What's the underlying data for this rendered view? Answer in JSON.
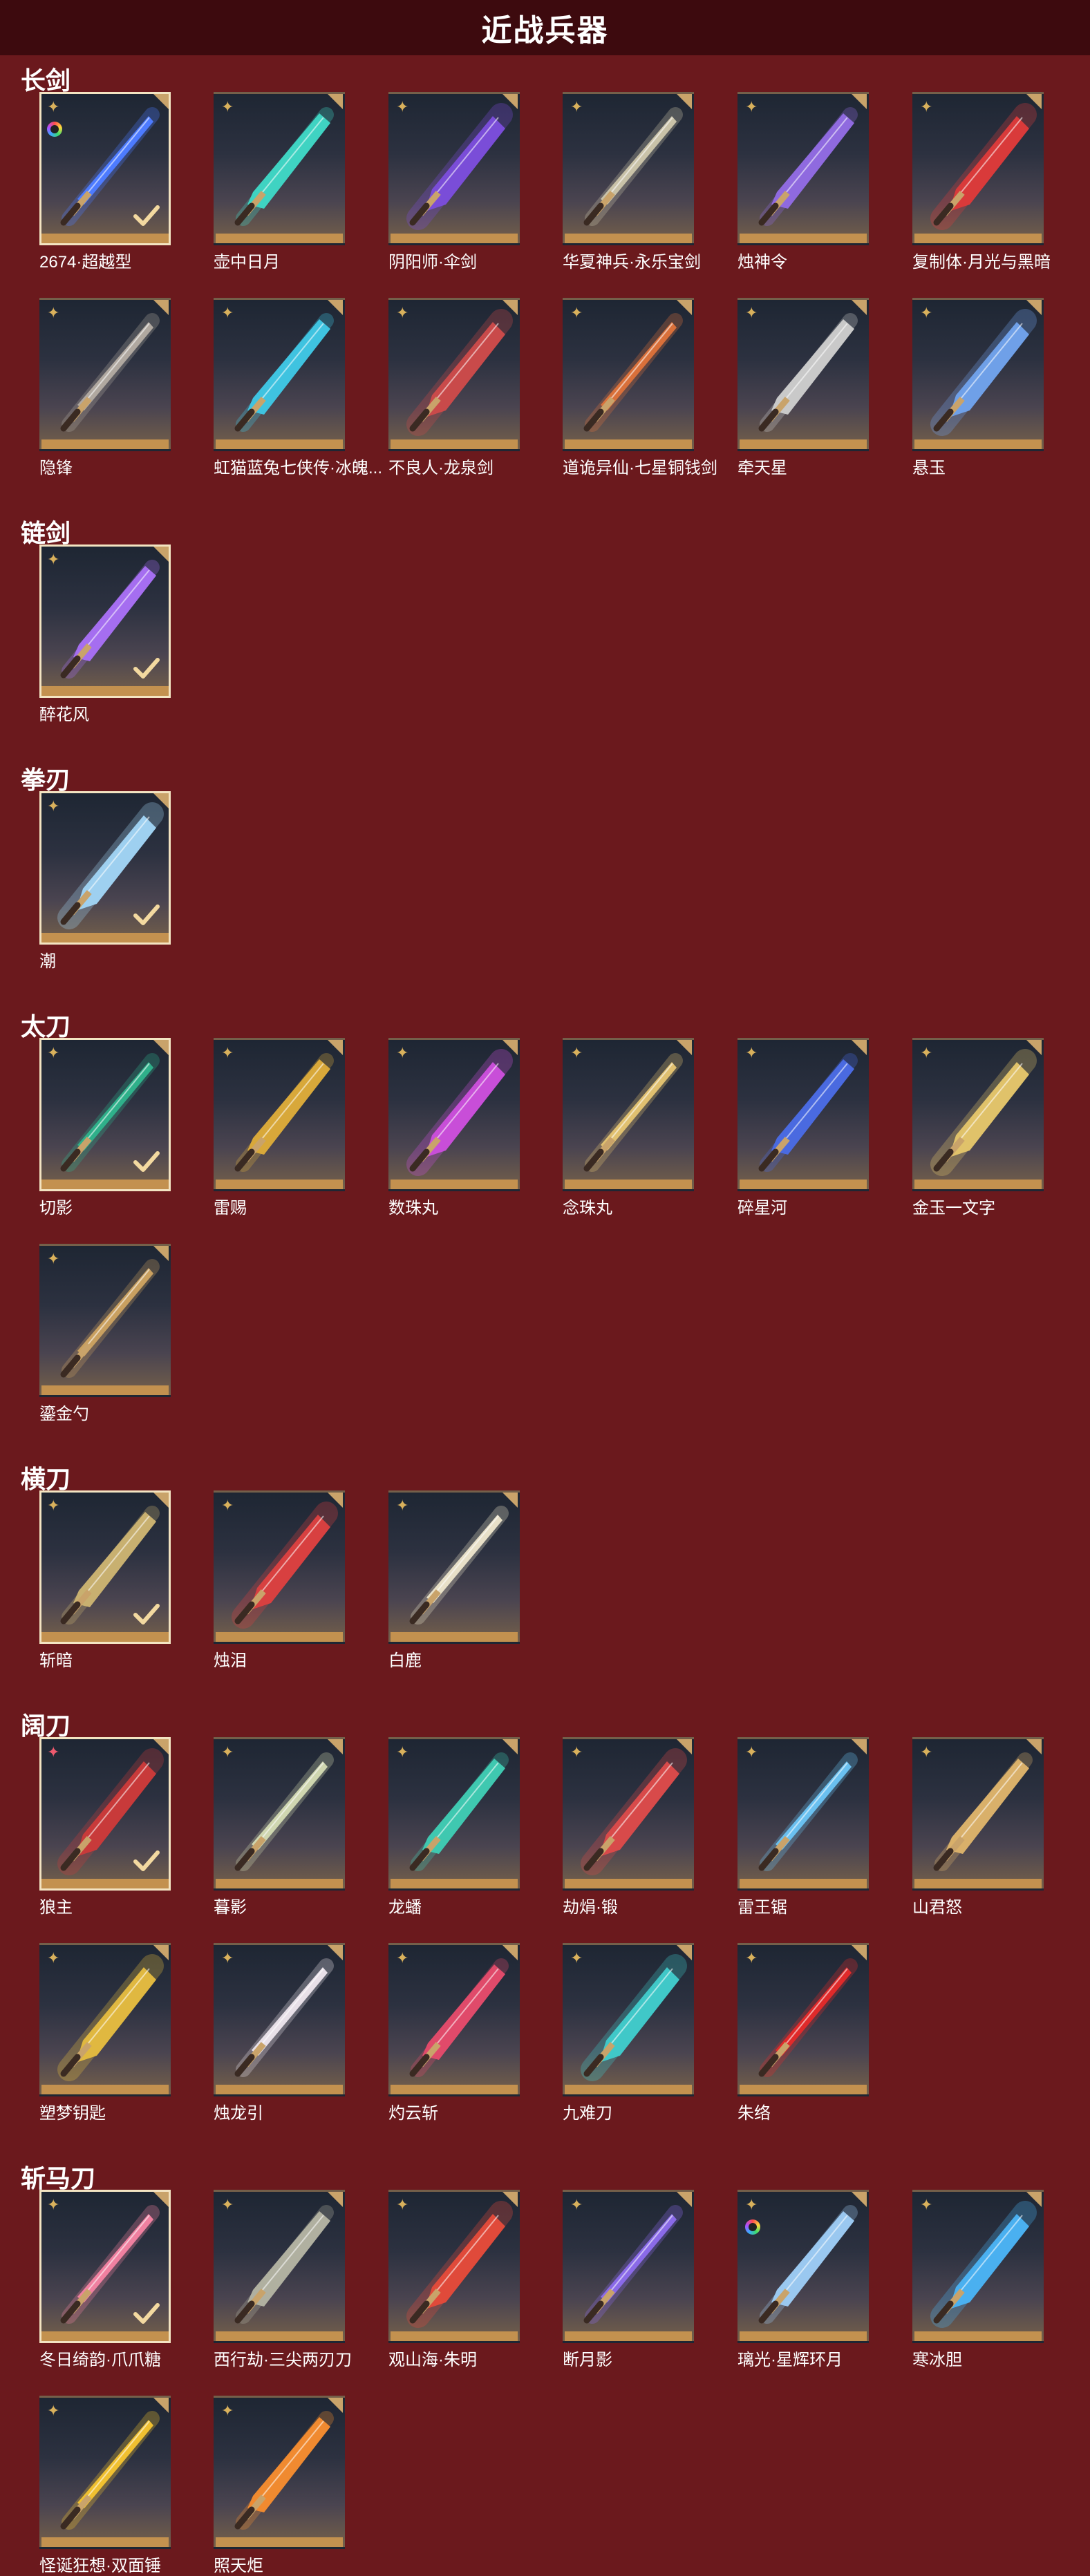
{
  "page": {
    "title": "近战兵器"
  },
  "categories": [
    {
      "name": "长剑",
      "items": [
        {
          "label": "2674·超越型",
          "star": "gold",
          "ring": true,
          "selected": true,
          "color": "#4d7bff"
        },
        {
          "label": "壶中日月",
          "star": "gold",
          "color": "#3fd3c2"
        },
        {
          "label": "阴阳师·伞剑",
          "star": "gold",
          "color": "#7a4dd8"
        },
        {
          "label": "华夏神兵·永乐宝剑",
          "star": "gold",
          "color": "#c9c2a8"
        },
        {
          "label": "烛神令",
          "star": "gold",
          "color": "#8f6adf"
        },
        {
          "label": "复制体·月光与黑暗",
          "star": "gold",
          "color": "#d93a3a"
        },
        {
          "label": "隐锋",
          "star": "gold",
          "color": "#b0a8a0"
        },
        {
          "label": "虹猫蓝兔七侠传·冰魄...",
          "star": "gold",
          "color": "#3fc3e0"
        },
        {
          "label": "不良人·龙泉剑",
          "star": "gold",
          "color": "#c94a4a"
        },
        {
          "label": "道诡异仙·七星铜钱剑",
          "star": "gold",
          "color": "#d9703a"
        },
        {
          "label": "牵天星",
          "star": "gold",
          "color": "#c9c9c9"
        },
        {
          "label": "悬玉",
          "star": "gold",
          "color": "#6fa0e8"
        }
      ]
    },
    {
      "name": "链剑",
      "items": [
        {
          "label": "醉花风",
          "star": "gold",
          "selected": true,
          "color": "#a56ef0"
        }
      ]
    },
    {
      "name": "拳刃",
      "items": [
        {
          "label": "潮",
          "star": "gold",
          "selected": true,
          "color": "#9ed0f0"
        }
      ]
    },
    {
      "name": "太刀",
      "items": [
        {
          "label": "切影",
          "star": "gold",
          "selected": true,
          "color": "#2fb08a"
        },
        {
          "label": "雷赐",
          "star": "gold",
          "color": "#d8a83a"
        },
        {
          "label": "数珠丸",
          "star": "gold",
          "color": "#c84ed8"
        },
        {
          "label": "念珠丸",
          "star": "gold",
          "color": "#e0c070"
        },
        {
          "label": "碎星河",
          "star": "gold",
          "color": "#4a6ae0"
        },
        {
          "label": "金玉一文字",
          "star": "gold",
          "color": "#e0c26a"
        },
        {
          "label": "鎏金勺",
          "star": "gold",
          "color": "#c9a060"
        }
      ]
    },
    {
      "name": "横刀",
      "items": [
        {
          "label": "斩暗",
          "star": "gold",
          "selected": true,
          "color": "#c8b070"
        },
        {
          "label": "烛泪",
          "star": "gold",
          "color": "#d84040"
        },
        {
          "label": "白鹿",
          "star": "gold",
          "color": "#e8e0c8"
        }
      ]
    },
    {
      "name": "阔刀",
      "items": [
        {
          "label": "狼主",
          "star": "pink",
          "selected": true,
          "color": "#c83a3a"
        },
        {
          "label": "暮影",
          "star": "gold",
          "color": "#cfd6b0"
        },
        {
          "label": "龙蟠",
          "star": "gold",
          "color": "#3fc8b0"
        },
        {
          "label": "劫焆·锻",
          "star": "gold",
          "color": "#d84a4a"
        },
        {
          "label": "雷王锯",
          "star": "gold",
          "color": "#6ac0f0"
        },
        {
          "label": "山君怒",
          "star": "gold",
          "color": "#d9b06a"
        },
        {
          "label": "塑梦钥匙",
          "star": "gold",
          "color": "#e0b840"
        },
        {
          "label": "烛龙引",
          "star": "gold",
          "color": "#e8e0e8"
        },
        {
          "label": "灼云斩",
          "star": "gold",
          "color": "#e04a6a"
        },
        {
          "label": "九难刀",
          "star": "gold",
          "color": "#40c8c8"
        },
        {
          "label": "朱络",
          "star": "gold",
          "color": "#e02a2a"
        }
      ]
    },
    {
      "name": "斩马刀",
      "items": [
        {
          "label": "冬日绮韵·爪爪糖",
          "star": "gold",
          "selected": true,
          "color": "#f080a0"
        },
        {
          "label": "西行劫·三尖两刃刀",
          "star": "gold",
          "color": "#b0b0a0"
        },
        {
          "label": "观山海·朱明",
          "star": "gold",
          "color": "#e04a3a"
        },
        {
          "label": "断月影",
          "star": "gold",
          "color": "#8a6ae8"
        },
        {
          "label": "璃光·星辉环月",
          "star": "gold",
          "ring": true,
          "color": "#9ac8f0"
        },
        {
          "label": "寒冰胆",
          "star": "gold",
          "color": "#4ab0f0"
        },
        {
          "label": "怪诞狂想·双面锤",
          "star": "gold",
          "color": "#f0c030"
        },
        {
          "label": "照天炬",
          "star": "gold",
          "color": "#f08a30"
        }
      ]
    }
  ]
}
